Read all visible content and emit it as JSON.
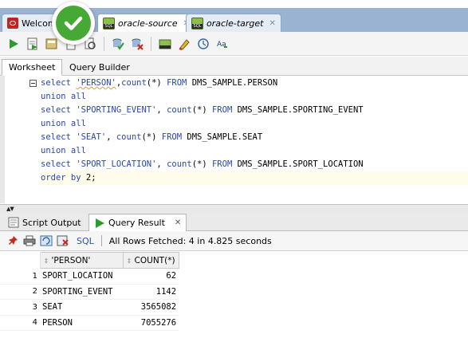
{
  "editor_tabs": [
    {
      "label": "Welcome",
      "active": false
    },
    {
      "label": "oracle-source",
      "active": true
    },
    {
      "label": "oracle-target",
      "active": false
    }
  ],
  "status_badge": "check-mark",
  "toolbar_icons": [
    "run-statement-icon",
    "run-script-icon",
    "autotrace-icon",
    "explain-plan-icon",
    "sql-tuning-icon",
    "commit-icon",
    "rollback-icon",
    "unshared-sql-icon",
    "clear-icon",
    "history-icon",
    "format-icon"
  ],
  "worksheet_tabs": [
    {
      "label": "Worksheet",
      "active": true
    },
    {
      "label": "Query Builder",
      "active": false
    }
  ],
  "sql_lines": [
    [
      {
        "t": "kw",
        "v": "select "
      },
      {
        "t": "str",
        "v": "'PERSON'"
      },
      {
        "t": "txt",
        "v": ","
      },
      {
        "t": "kw",
        "v": "count"
      },
      {
        "t": "txt",
        "v": "(*) "
      },
      {
        "t": "kw",
        "v": "FROM "
      },
      {
        "t": "txt",
        "v": "DMS_SAMPLE.PERSON"
      }
    ],
    [
      {
        "t": "kw",
        "v": "union all"
      }
    ],
    [
      {
        "t": "kw",
        "v": "select "
      },
      {
        "t": "str",
        "v": "'SPORTING_EVENT'"
      },
      {
        "t": "txt",
        "v": ", "
      },
      {
        "t": "kw",
        "v": "count"
      },
      {
        "t": "txt",
        "v": "(*) "
      },
      {
        "t": "kw",
        "v": "FROM "
      },
      {
        "t": "txt",
        "v": "DMS_SAMPLE.SPORTING_EVENT"
      }
    ],
    [
      {
        "t": "kw",
        "v": "union all"
      }
    ],
    [
      {
        "t": "kw",
        "v": "select "
      },
      {
        "t": "str",
        "v": "'SEAT'"
      },
      {
        "t": "txt",
        "v": ", "
      },
      {
        "t": "kw",
        "v": "count"
      },
      {
        "t": "txt",
        "v": "(*) "
      },
      {
        "t": "kw",
        "v": "FROM "
      },
      {
        "t": "txt",
        "v": "DMS_SAMPLE.SEAT"
      }
    ],
    [
      {
        "t": "kw",
        "v": "union all"
      }
    ],
    [
      {
        "t": "kw",
        "v": "select "
      },
      {
        "t": "str",
        "v": "'SPORT_LOCATION'"
      },
      {
        "t": "txt",
        "v": ", "
      },
      {
        "t": "kw",
        "v": "count"
      },
      {
        "t": "txt",
        "v": "(*) "
      },
      {
        "t": "kw",
        "v": "FROM "
      },
      {
        "t": "txt",
        "v": "DMS_SAMPLE.SPORT_LOCATION"
      }
    ],
    [
      {
        "t": "kw",
        "v": "order by "
      },
      {
        "t": "txt",
        "v": "2;"
      }
    ]
  ],
  "output_tabs": [
    {
      "label": "Script Output",
      "active": false
    },
    {
      "label": "Query Result",
      "active": true
    }
  ],
  "result_toolbar": {
    "sql_label": "SQL",
    "status": "All Rows Fetched: 4 in 4.825 seconds"
  },
  "result_grid": {
    "columns": [
      "'PERSON'",
      "COUNT(*)"
    ],
    "rows": [
      {
        "n": "1",
        "c1": "SPORT_LOCATION",
        "c2": "62"
      },
      {
        "n": "2",
        "c1": "SPORTING_EVENT",
        "c2": "1142"
      },
      {
        "n": "3",
        "c1": "SEAT",
        "c2": "3565082"
      },
      {
        "n": "4",
        "c1": "PERSON",
        "c2": "7055276"
      }
    ]
  },
  "colors": {
    "keyword": "#2a47ad",
    "badge_green": "#46a935",
    "tab_strip": "#9ab3d3"
  }
}
